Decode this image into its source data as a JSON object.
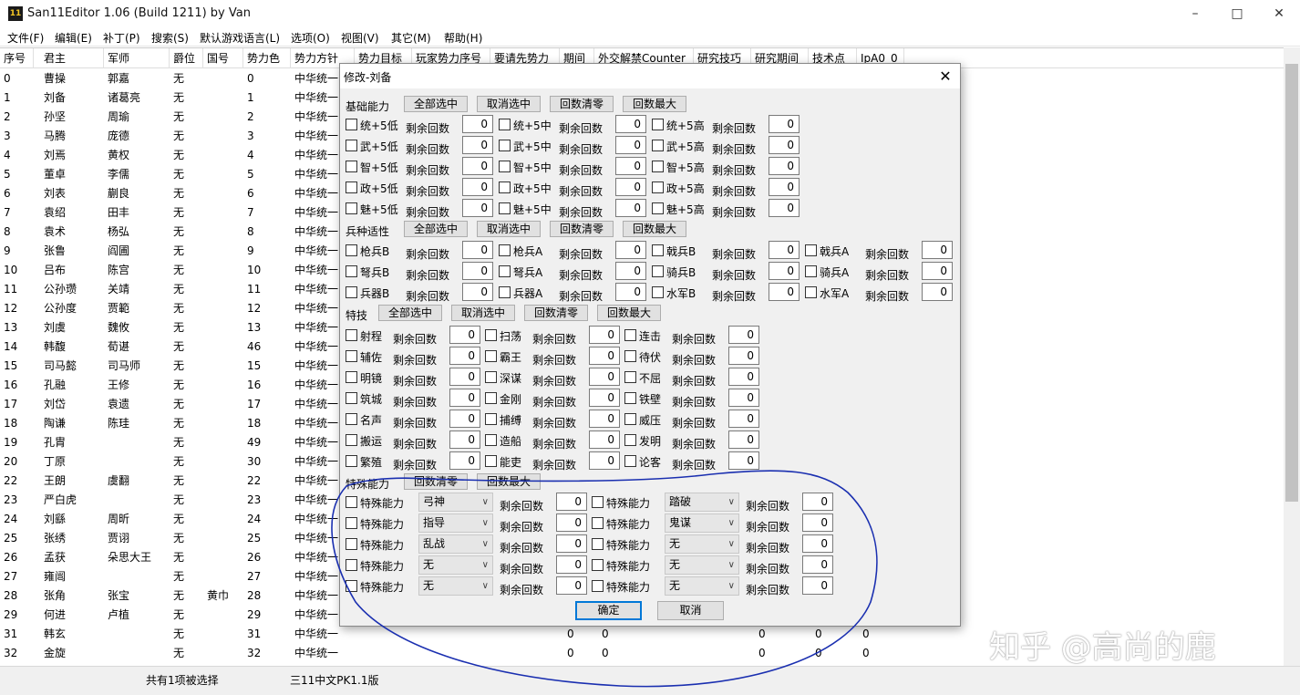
{
  "window": {
    "title": "San11Editor 1.06 (Build 1211) by Van",
    "icon_text": "11",
    "minimize_icon": "minimize-icon",
    "maximize_icon": "maximize-icon",
    "close_icon": "close-icon"
  },
  "menu": [
    "文件(F)",
    "编辑(E)",
    "补丁(P)",
    "搜索(S)",
    "默认游戏语言(L)",
    "选项(O)",
    "视图(V)",
    "其它(M)",
    "帮助(H)"
  ],
  "table": {
    "headers": [
      "序号",
      "君主",
      "军师",
      "爵位",
      "国号",
      "势力色",
      "势力方针",
      "势力目标",
      "玩家势力序号",
      "要请先势力",
      "期间",
      "外交解禁Counter",
      "研究技巧",
      "研究期间",
      "技术点",
      "IpA0_0"
    ],
    "rows": [
      [
        "0",
        "曹操",
        "郭嘉",
        "无",
        "",
        "0",
        "中华统一"
      ],
      [
        "1",
        "刘备",
        "诸葛亮",
        "无",
        "",
        "1",
        "中华统一"
      ],
      [
        "2",
        "孙坚",
        "周瑜",
        "无",
        "",
        "2",
        "中华统一"
      ],
      [
        "3",
        "马腾",
        "庞德",
        "无",
        "",
        "3",
        "中华统一"
      ],
      [
        "4",
        "刘焉",
        "黄权",
        "无",
        "",
        "4",
        "中华统一"
      ],
      [
        "5",
        "董卓",
        "李儒",
        "无",
        "",
        "5",
        "中华统一"
      ],
      [
        "6",
        "刘表",
        "蒯良",
        "无",
        "",
        "6",
        "中华统一"
      ],
      [
        "7",
        "袁绍",
        "田丰",
        "无",
        "",
        "7",
        "中华统一"
      ],
      [
        "8",
        "袁术",
        "杨弘",
        "无",
        "",
        "8",
        "中华统一"
      ],
      [
        "9",
        "张鲁",
        "阎圃",
        "无",
        "",
        "9",
        "中华统一"
      ],
      [
        "10",
        "吕布",
        "陈宫",
        "无",
        "",
        "10",
        "中华统一"
      ],
      [
        "11",
        "公孙瓒",
        "关靖",
        "无",
        "",
        "11",
        "中华统一"
      ],
      [
        "12",
        "公孙度",
        "贾範",
        "无",
        "",
        "12",
        "中华统一"
      ],
      [
        "13",
        "刘虞",
        "魏攸",
        "无",
        "",
        "13",
        "中华统一"
      ],
      [
        "14",
        "韩馥",
        "荀谌",
        "无",
        "",
        "46",
        "中华统一"
      ],
      [
        "15",
        "司马懿",
        "司马师",
        "无",
        "",
        "15",
        "中华统一"
      ],
      [
        "16",
        "孔融",
        "王修",
        "无",
        "",
        "16",
        "中华统一"
      ],
      [
        "17",
        "刘岱",
        "袁遗",
        "无",
        "",
        "17",
        "中华统一"
      ],
      [
        "18",
        "陶谦",
        "陈珪",
        "无",
        "",
        "18",
        "中华统一"
      ],
      [
        "19",
        "孔胄",
        "",
        "无",
        "",
        "49",
        "中华统一"
      ],
      [
        "20",
        "丁原",
        "",
        "无",
        "",
        "30",
        "中华统一"
      ],
      [
        "22",
        "王朗",
        "虞翻",
        "无",
        "",
        "22",
        "中华统一"
      ],
      [
        "23",
        "严白虎",
        "",
        "无",
        "",
        "23",
        "中华统一"
      ],
      [
        "24",
        "刘繇",
        "周昕",
        "无",
        "",
        "24",
        "中华统一"
      ],
      [
        "25",
        "张绣",
        "贾诩",
        "无",
        "",
        "25",
        "中华统一"
      ],
      [
        "26",
        "孟获",
        "朵思大王",
        "无",
        "",
        "26",
        "中华统一"
      ],
      [
        "27",
        "雍闿",
        "",
        "无",
        "",
        "27",
        "中华统一"
      ],
      [
        "28",
        "张角",
        "张宝",
        "无",
        "黄巾",
        "28",
        "中华统一"
      ],
      [
        "29",
        "何进",
        "卢植",
        "无",
        "",
        "29",
        "中华统一"
      ],
      [
        "31",
        "韩玄",
        "",
        "无",
        "",
        "31",
        "中华统一"
      ],
      [
        "32",
        "金旋",
        "",
        "无",
        "",
        "32",
        "中华统一"
      ]
    ],
    "extra_rows": [
      [
        "0",
        "0",
        "0",
        "0",
        "0"
      ],
      [
        "0",
        "0",
        "0",
        "0",
        "0"
      ]
    ]
  },
  "status": {
    "selection": "共有1项被选择",
    "version": "三11中文PK1.1版"
  },
  "dialog": {
    "title": "修改-刘备",
    "close_icon": "close-icon",
    "remaining": "剩余回数",
    "groups": {
      "basic": "基础能力",
      "troop": "兵种适性",
      "skill": "特技",
      "special": "特殊能力"
    },
    "buttons": {
      "select_all": "全部选中",
      "deselect_all": "取消选中",
      "clear": "回数清零",
      "max": "回数最大",
      "ok": "确定",
      "cancel": "取消"
    },
    "basic_items": [
      [
        "统+5低",
        "统+5中",
        "统+5高"
      ],
      [
        "武+5低",
        "武+5中",
        "武+5高"
      ],
      [
        "智+5低",
        "智+5中",
        "智+5高"
      ],
      [
        "政+5低",
        "政+5中",
        "政+5高"
      ],
      [
        "魅+5低",
        "魅+5中",
        "魅+5高"
      ]
    ],
    "troop_items": [
      [
        "枪兵B",
        "枪兵A",
        "戟兵B",
        "戟兵A"
      ],
      [
        "弩兵B",
        "弩兵A",
        "骑兵B",
        "骑兵A"
      ],
      [
        "兵器B",
        "兵器A",
        "水军B",
        "水军A"
      ]
    ],
    "skill_items": [
      [
        "射程",
        "扫荡",
        "连击"
      ],
      [
        "辅佐",
        "霸王",
        "待伏"
      ],
      [
        "明镜",
        "深谋",
        "不屈"
      ],
      [
        "筑城",
        "金刚",
        "铁壁"
      ],
      [
        "名声",
        "捕缚",
        "威压"
      ],
      [
        "搬运",
        "造船",
        "发明"
      ],
      [
        "繁殖",
        "能吏",
        "论客"
      ]
    ],
    "special_label": "特殊能力",
    "special_left": [
      "弓神",
      "指导",
      "乱战",
      "无",
      "无"
    ],
    "special_right": [
      "踏破",
      "鬼谋",
      "无",
      "无",
      "无"
    ],
    "value": "0"
  },
  "watermark": "知乎 @高尚的鹿",
  "annotation_color": "#1a2fb0"
}
